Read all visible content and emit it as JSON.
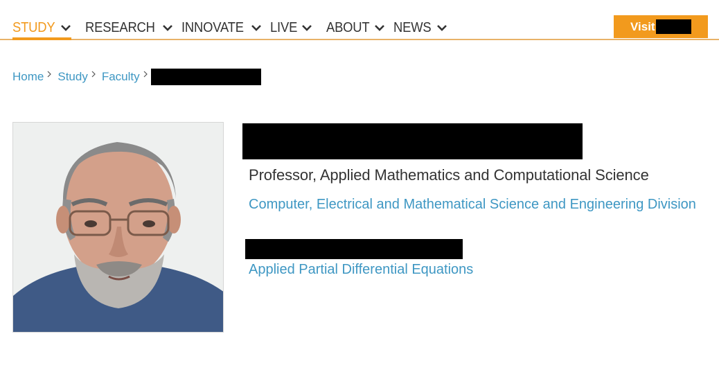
{
  "nav": {
    "items": [
      {
        "label": "STUDY",
        "active": true
      },
      {
        "label": "RESEARCH",
        "active": false
      },
      {
        "label": "INNOVATE",
        "active": false
      },
      {
        "label": "LIVE",
        "active": false
      },
      {
        "label": "ABOUT",
        "active": false
      },
      {
        "label": "NEWS",
        "active": false
      }
    ],
    "visit_label": "Visit",
    "chevron_icon": "chevron-down-icon"
  },
  "breadcrumb": {
    "items": [
      "Home",
      "Study",
      "Faculty"
    ],
    "separator_icon": "chevron-right-icon"
  },
  "profile": {
    "title": "Professor, Applied Mathematics and Computational Science",
    "division": "Computer, Electrical and Mathematical Science and Engineering Division",
    "research_group": "Applied Partial Differential Equations"
  },
  "colors": {
    "accent": "#f29a1d",
    "link": "#3e97c3",
    "text": "#333333",
    "nav_rule": "#e8b268"
  }
}
